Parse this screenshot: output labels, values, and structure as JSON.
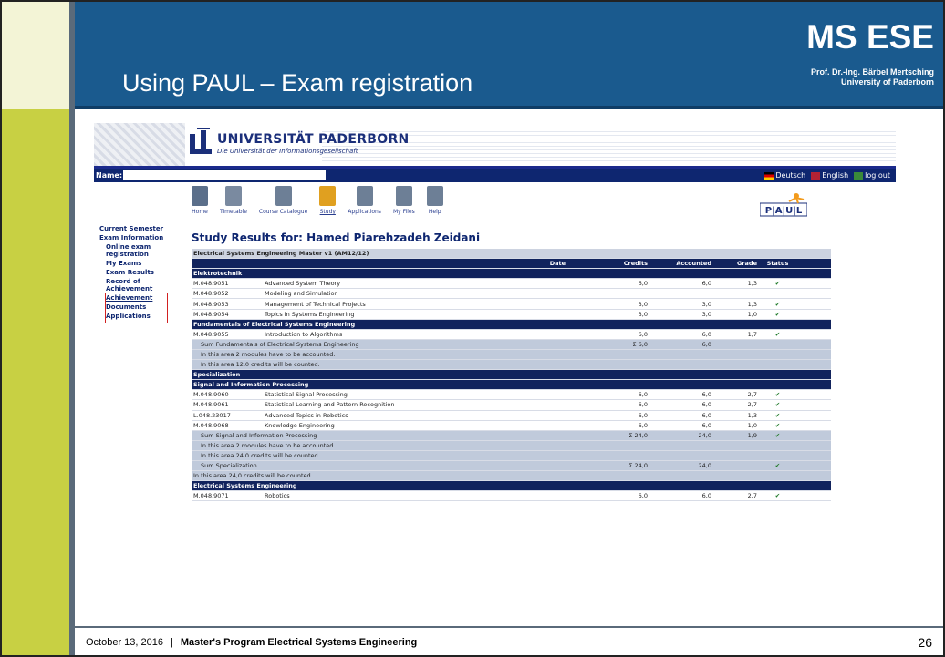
{
  "slide": {
    "title": "Using PAUL – Exam registration",
    "brand": "MS ESE",
    "brand_sub1": "Prof. Dr.-Ing. Bärbel Mertsching",
    "brand_sub2": "University of Paderborn",
    "footer_date": "October 13, 2016",
    "footer_sep": "|",
    "footer_program": "Master's Program Electrical Systems Engineering",
    "page_number": "26"
  },
  "header": {
    "university": "UNIVERSITÄT PADERBORN",
    "tagline": "Die Universität der Informationsgesellschaft",
    "name_label": "Name:",
    "lang_de": "Deutsch",
    "lang_en": "English",
    "logout": "log out"
  },
  "nav_icons": [
    {
      "label": "Home",
      "icon": "home-icon"
    },
    {
      "label": "Timetable",
      "icon": "timetable-icon"
    },
    {
      "label": "Course Catalogue",
      "icon": "catalogue-icon"
    },
    {
      "label": "Study",
      "icon": "study-icon"
    },
    {
      "label": "Applications",
      "icon": "applications-icon"
    },
    {
      "label": "My Files",
      "icon": "files-icon"
    },
    {
      "label": "Help",
      "icon": "help-icon"
    }
  ],
  "logo_text": "P|A|U|L",
  "sidebar": {
    "current_semester": "Current Semester",
    "exam_information": "Exam Information",
    "online1": "Online exam",
    "online2": "registration",
    "my_exams": "My Exams",
    "exam_results": "Exam Results",
    "record1": "Record of",
    "record2": "Achievement",
    "achievement": "Achievement",
    "documents": "Documents",
    "applications": "Applications"
  },
  "results_title": "Study Results for: Hamed Piarehzadeh Zeidani",
  "table": {
    "program": "Electrical Systems Engineering Master v1 (AM12/12)",
    "col_date": "Date",
    "col_credits": "Credits",
    "col_accounted": "Accounted",
    "col_grade": "Grade",
    "col_status": "Status",
    "group_elektro": "Elektrotechnik",
    "r1": {
      "code": "M.048.9051",
      "title": "Advanced System Theory",
      "credits": "6,0",
      "acc": "6,0",
      "grade": "1,3",
      "status": "✔"
    },
    "r2": {
      "code": "M.048.9052",
      "title": "Modeling and Simulation"
    },
    "r3": {
      "code": "M.048.9053",
      "title": "Management of Technical Projects",
      "credits": "3,0",
      "acc": "3,0",
      "grade": "1,3",
      "status": "✔"
    },
    "r4": {
      "code": "M.048.9054",
      "title": "Topics in Systems Engineering",
      "credits": "3,0",
      "acc": "3,0",
      "grade": "1,0",
      "status": "✔"
    },
    "group_fund": "Fundamentals of Electrical Systems Engineering",
    "r5": {
      "code": "M.048.9055",
      "title": "Introduction to Algorithms",
      "credits": "6,0",
      "acc": "6,0",
      "grade": "1,7",
      "status": "✔"
    },
    "sum_fund": {
      "title": "Sum Fundamentals of Electrical Systems Engineering",
      "credits": "Σ 6,0",
      "acc": "6,0"
    },
    "note_fund1": "In this area 2 modules have to be accounted.",
    "note_fund2": "In this area 12,0 credits will be counted.",
    "group_spec": "Specialization",
    "group_sig": "Signal and Information Processing",
    "r6": {
      "code": "M.048.9060",
      "title": "Statistical Signal Processing",
      "credits": "6,0",
      "acc": "6,0",
      "grade": "2,7",
      "status": "✔"
    },
    "r7": {
      "code": "M.048.9061",
      "title": "Statistical Learning and Pattern Recognition",
      "credits": "6,0",
      "acc": "6,0",
      "grade": "2,7",
      "status": "✔"
    },
    "r8": {
      "code": "L.048.23017",
      "title": "Advanced Topics in Robotics",
      "credits": "6,0",
      "acc": "6,0",
      "grade": "1,3",
      "status": "✔"
    },
    "r9": {
      "code": "M.048.9068",
      "title": "Knowledge Engineering",
      "credits": "6,0",
      "acc": "6,0",
      "grade": "1,0",
      "status": "✔"
    },
    "sum_sig": {
      "title": "Sum Signal and Information Processing",
      "credits": "Σ 24,0",
      "acc": "24,0",
      "grade": "1,9",
      "status": "✔"
    },
    "note_sig1": "In this area 2 modules have to be accounted.",
    "note_sig2": "In this area 24,0 credits will be counted.",
    "sum_spec": {
      "title": "Sum Specialization",
      "credits": "Σ 24,0",
      "acc": "24,0",
      "status": "✔"
    },
    "note_spec": "In this area 24,0 credits will be counted.",
    "group_ese": "Electrical Systems Engineering",
    "r10": {
      "code": "M.048.9071",
      "title": "Robotics",
      "credits": "6,0",
      "acc": "6,0",
      "grade": "2,7",
      "status": "✔"
    }
  },
  "colors": {
    "header_blue": "#1a5a8e",
    "left_strip": "#c8d043",
    "paul_navy": "#0e2670",
    "highlight_red": "#d12020"
  }
}
